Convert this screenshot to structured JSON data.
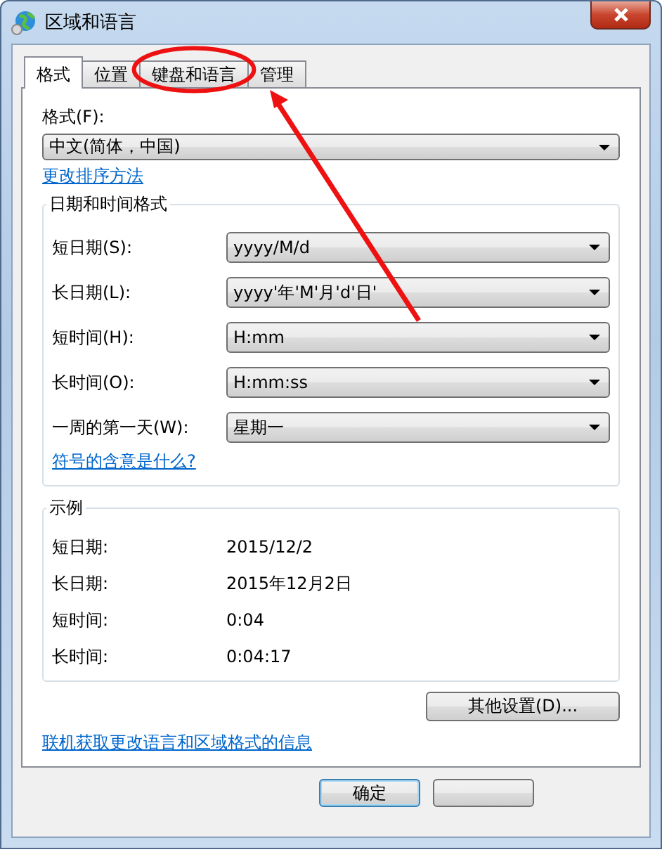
{
  "window": {
    "title": "区域和语言"
  },
  "tabs": [
    {
      "label": "格式",
      "selected": true,
      "circled": false
    },
    {
      "label": "位置",
      "selected": false,
      "circled": false
    },
    {
      "label": "键盘和语言",
      "selected": false,
      "circled": true
    },
    {
      "label": "管理",
      "selected": false,
      "circled": false
    }
  ],
  "format": {
    "label": "格式(F):",
    "value": "中文(简体，中国)"
  },
  "sort_link": "更改排序方法",
  "date_time_formats": {
    "title": "日期和时间格式",
    "rows": [
      {
        "label": "短日期(S):",
        "value": "yyyy/M/d"
      },
      {
        "label": "长日期(L):",
        "value": "yyyy'年'M'月'd'日'"
      },
      {
        "label": "短时间(H):",
        "value": "H:mm"
      },
      {
        "label": "长时间(O):",
        "value": "H:mm:ss"
      },
      {
        "label": "一周的第一天(W):",
        "value": "星期一"
      }
    ],
    "help_link": "符号的含意是什么?"
  },
  "examples": {
    "title": "示例",
    "rows": [
      {
        "label": "短日期:",
        "value": "2015/12/2"
      },
      {
        "label": "长日期:",
        "value": "2015年12月2日"
      },
      {
        "label": "短时间:",
        "value": "0:04"
      },
      {
        "label": "长时间:",
        "value": "0:04:17"
      }
    ]
  },
  "other_settings_button": "其他设置(D)...",
  "online_link": "联机获取更改语言和区域格式的信息",
  "buttons": [
    {
      "label": "确定",
      "default": true
    },
    {
      "default": false
    }
  ],
  "annotation": {
    "kind": "circle-and-arrow"
  }
}
